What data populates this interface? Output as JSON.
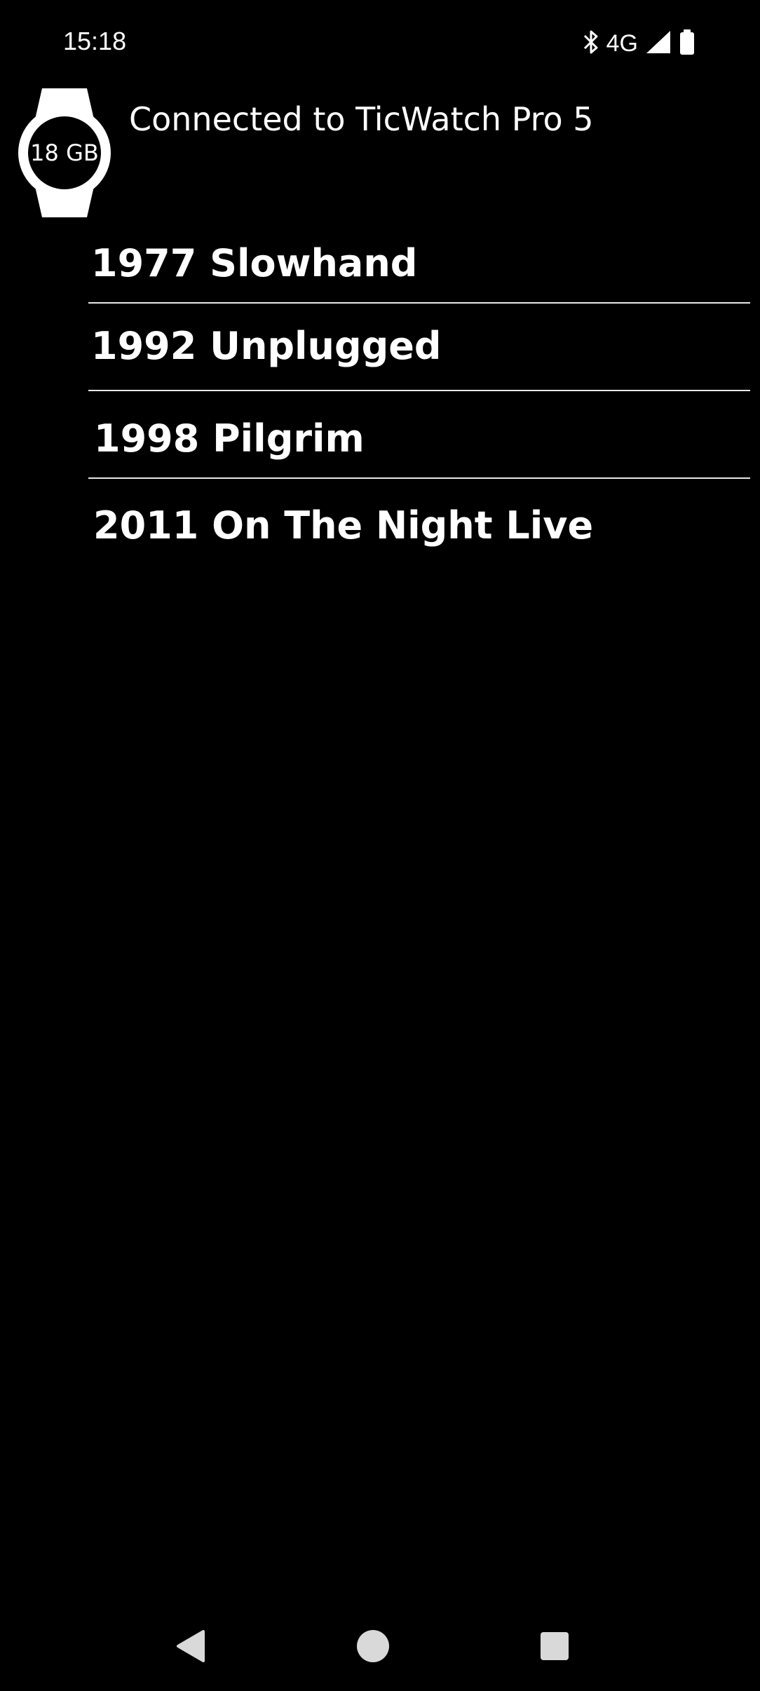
{
  "status_bar": {
    "time": "15:18",
    "network": "4G",
    "icons": [
      "bluetooth-icon",
      "signal-icon",
      "battery-icon"
    ]
  },
  "header": {
    "watch_storage": "18 GB",
    "title": "Connected to TicWatch Pro 5"
  },
  "albums": [
    {
      "label": "1977 Slowhand"
    },
    {
      "label": "1992 Unplugged"
    },
    {
      "label": "1998 Pilgrim"
    },
    {
      "label": "2011 On The Night Live"
    }
  ],
  "nav_bar": {
    "icons": [
      "back-icon",
      "home-icon",
      "recents-icon"
    ]
  },
  "colors": {
    "background": "#000000",
    "text": "#ffffff",
    "divider": "#e8e8e8"
  }
}
